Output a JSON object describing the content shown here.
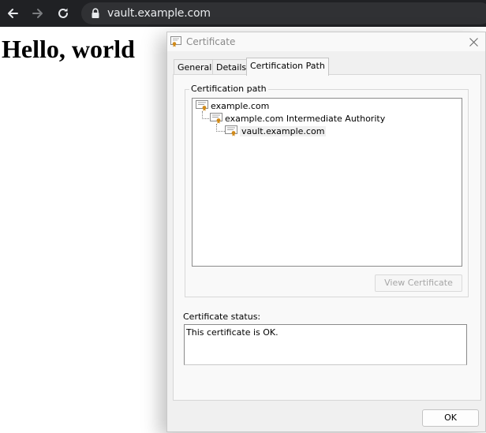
{
  "browser": {
    "url": "vault.example.com",
    "back_icon": "arrow-left-icon",
    "forward_icon": "arrow-right-icon",
    "reload_icon": "reload-icon",
    "lock_icon": "lock-icon"
  },
  "page": {
    "heading": "Hello, world"
  },
  "dialog": {
    "title": "Certificate",
    "tabs": [
      {
        "label": "General",
        "active": false
      },
      {
        "label": "Details",
        "active": false
      },
      {
        "label": "Certification Path",
        "active": true
      }
    ],
    "cert_path": {
      "group_label": "Certification path",
      "items": [
        {
          "label": "example.com",
          "level": 0,
          "selected": false
        },
        {
          "label": "example.com Intermediate Authority",
          "level": 1,
          "selected": false
        },
        {
          "label": "vault.example.com",
          "level": 2,
          "selected": true
        }
      ],
      "view_button_label": "View Certificate"
    },
    "status": {
      "label": "Certificate status:",
      "text": "This certificate is OK."
    },
    "ok_label": "OK"
  },
  "colors": {
    "browser_bar": "#202124",
    "omnibox": "#303134",
    "dialog_bg": "#f0f0f0",
    "cert_icon_seal": "#d08a1a"
  }
}
